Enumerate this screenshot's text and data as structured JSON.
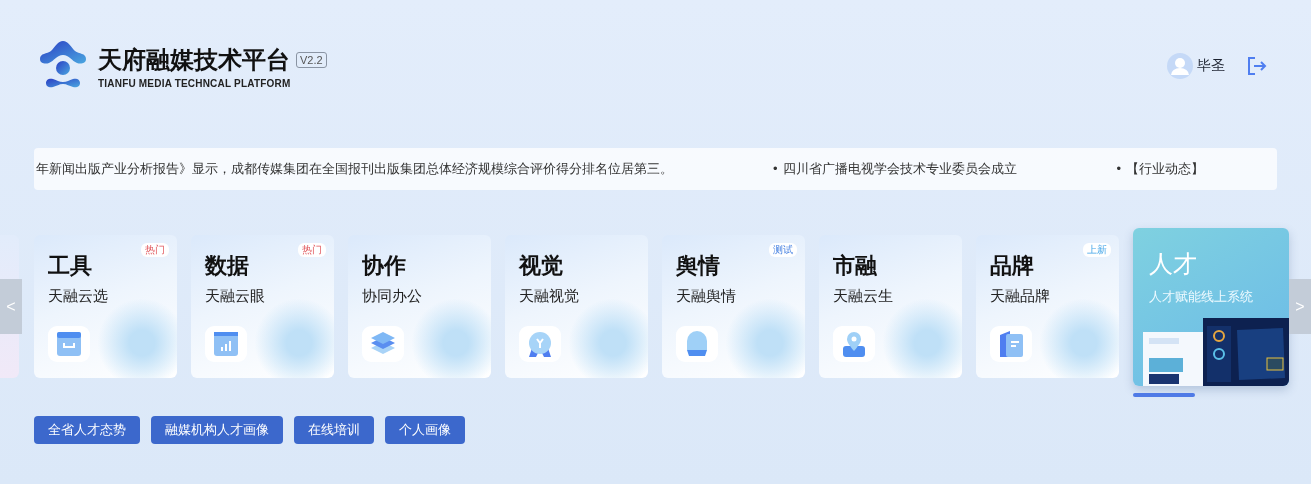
{
  "header": {
    "title": "天府融媒技术平台",
    "version": "V2.2",
    "subtitle": "TIANFU MEDIA TECHNCAL PLATFORM",
    "user": "毕圣"
  },
  "ticker": [
    {
      "text": "年新闻出版产业分析报告》显示，成都传媒集团在全国报刊出版集团总体经济规模综合评价得分排名位居第三。"
    },
    {
      "bullet": "•",
      "text": "四川省广播电视学会技术专业委员会成立"
    },
    {
      "bullet": "•",
      "text": "【行业动态】"
    }
  ],
  "carousel": {
    "prev": "<",
    "next": ">",
    "cards": [
      {
        "title": "工具",
        "subtitle": "天融云选",
        "badge": {
          "text": "热门",
          "kind": "hot"
        },
        "selected": false
      },
      {
        "title": "数据",
        "subtitle": "天融云眼",
        "badge": {
          "text": "热门",
          "kind": "hot"
        },
        "selected": false
      },
      {
        "title": "协作",
        "subtitle": "协同办公",
        "selected": false
      },
      {
        "title": "视觉",
        "subtitle": "天融视觉",
        "selected": false
      },
      {
        "title": "舆情",
        "subtitle": "天融舆情",
        "badge": {
          "text": "测试",
          "kind": "test"
        },
        "selected": false
      },
      {
        "title": "市融",
        "subtitle": "天融云生",
        "selected": false
      },
      {
        "title": "品牌",
        "subtitle": "天融品牌",
        "badge": {
          "text": "上新",
          "kind": "new"
        },
        "selected": false
      },
      {
        "title": "人才",
        "subtitle": "人才赋能线上系统",
        "selected": true
      }
    ]
  },
  "actions": [
    "全省人才态势",
    "融媒机构人才画像",
    "在线培训",
    "个人画像"
  ]
}
